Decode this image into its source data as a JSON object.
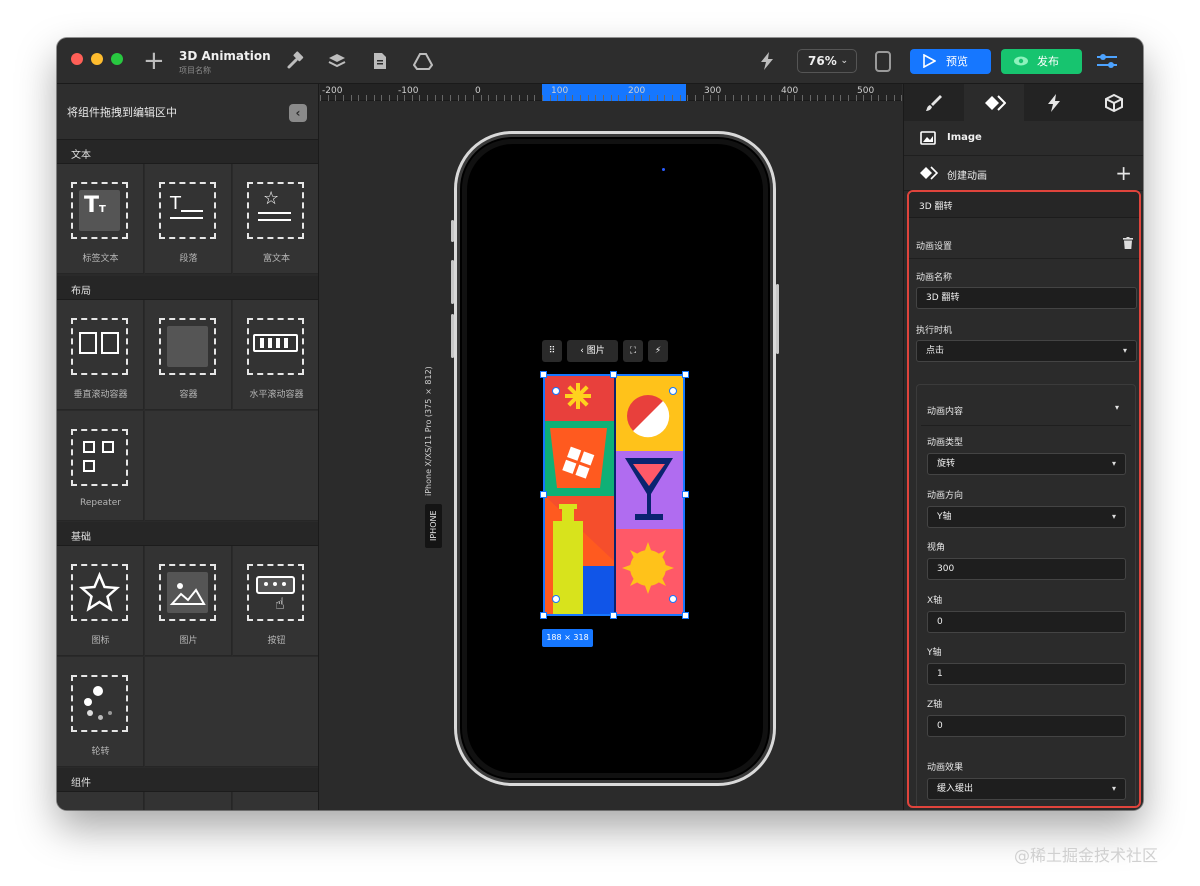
{
  "window": {
    "title": "3D Animation",
    "subtitle": "项目名称",
    "zoom": "76%",
    "preview_label": "预览",
    "publish_label": "发布",
    "colors": {
      "preview": "#1677ff",
      "publish": "#17c46f",
      "selection": "#1677ff",
      "highlight": "#e0443c"
    }
  },
  "left_panel": {
    "header": "将组件拖拽到编辑区中",
    "sections": [
      {
        "title": "文本",
        "items": [
          {
            "label": "标签文本",
            "icon": "label-text-icon"
          },
          {
            "label": "段落",
            "icon": "paragraph-icon"
          },
          {
            "label": "富文本",
            "icon": "rich-text-icon"
          }
        ]
      },
      {
        "title": "布局",
        "items": [
          {
            "label": "垂直滚动容器",
            "icon": "vertical-scroll-icon"
          },
          {
            "label": "容器",
            "icon": "container-icon"
          },
          {
            "label": "水平滚动容器",
            "icon": "horizontal-scroll-icon"
          },
          {
            "label": "Repeater",
            "icon": "repeater-icon"
          }
        ]
      },
      {
        "title": "基础",
        "items": [
          {
            "label": "图标",
            "icon": "star-icon"
          },
          {
            "label": "图片",
            "icon": "image-icon"
          },
          {
            "label": "按钮",
            "icon": "button-icon"
          },
          {
            "label": "轮转",
            "icon": "spinner-icon"
          }
        ]
      },
      {
        "title": "组件",
        "items": []
      }
    ]
  },
  "canvas": {
    "ruler_labels": [
      "-200",
      "-100",
      "0",
      "100",
      "200",
      "300",
      "400",
      "500"
    ],
    "device_name": "iPhone X/XS/11 Pro (375 × 812)",
    "device_tag": "IPHONE",
    "toolbar_back_label": "图片",
    "selection_size": "188 × 318"
  },
  "right_panel": {
    "tabs": [
      "brush-icon",
      "animation-icon",
      "interaction-icon",
      "cube-icon"
    ],
    "element_name": "Image",
    "create_animation_label": "创建动画",
    "animation": {
      "title": "3D 翻转",
      "settings_label": "动画设置",
      "name_label": "动画名称",
      "name_value": "3D 翻转",
      "trigger_label": "执行时机",
      "trigger_value": "点击",
      "content_label": "动画内容",
      "type_label": "动画类型",
      "type_value": "旋转",
      "direction_label": "动画方向",
      "direction_value": "Y轴",
      "perspective_label": "视角",
      "perspective_value": "300",
      "x_label": "X轴",
      "x_value": "0",
      "y_label": "Y轴",
      "y_value": "1",
      "z_label": "Z轴",
      "z_value": "0",
      "effect_label": "动画效果",
      "effect_value": "缓入缓出"
    }
  },
  "watermark": "@稀土掘金技术社区"
}
